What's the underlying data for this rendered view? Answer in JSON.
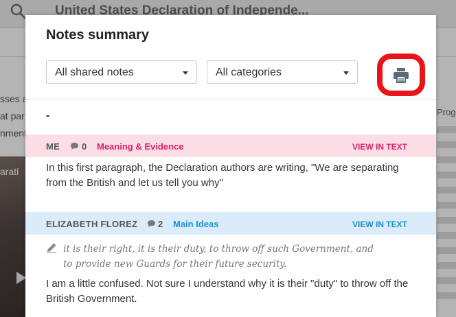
{
  "background": {
    "page_title": "United States Declaration of Independe...",
    "side_text_lines": [
      "sses a",
      "at par",
      "nment."
    ],
    "video_label": "arati",
    "right_label": "Prog"
  },
  "modal": {
    "title": "Notes summary",
    "filter_shared": {
      "selected": "All shared notes"
    },
    "filter_category": {
      "selected": "All categories"
    },
    "print_icon": "printer-icon",
    "section_heading": "-"
  },
  "notes": [
    {
      "author": "ME",
      "comment_count": "0",
      "category": "Meaning & Evidence",
      "view_link": "VIEW IN TEXT",
      "color": "#fbdde6",
      "body": "In this first paragraph, the Declaration authors are writing, \"We are separating from the British and let us tell you why\""
    },
    {
      "author": "ELIZABETH FLOREZ",
      "comment_count": "2",
      "category": "Main Ideas",
      "view_link": "VIEW IN TEXT",
      "color": "#daecfa",
      "quote_line1": "it is their right, it is their duty, to throw off such Government, and",
      "quote_line2": "to provide new Guards for their future security.",
      "body": "I am a little confused. Not sure I understand why it is their \"duty\" to throw off the British Government."
    }
  ],
  "colors": {
    "highlight_ring": "#e8141a",
    "meaning_evidence": "#d8226a",
    "main_ideas": "#1d8fd6",
    "print_icon": "#5a6a78"
  }
}
